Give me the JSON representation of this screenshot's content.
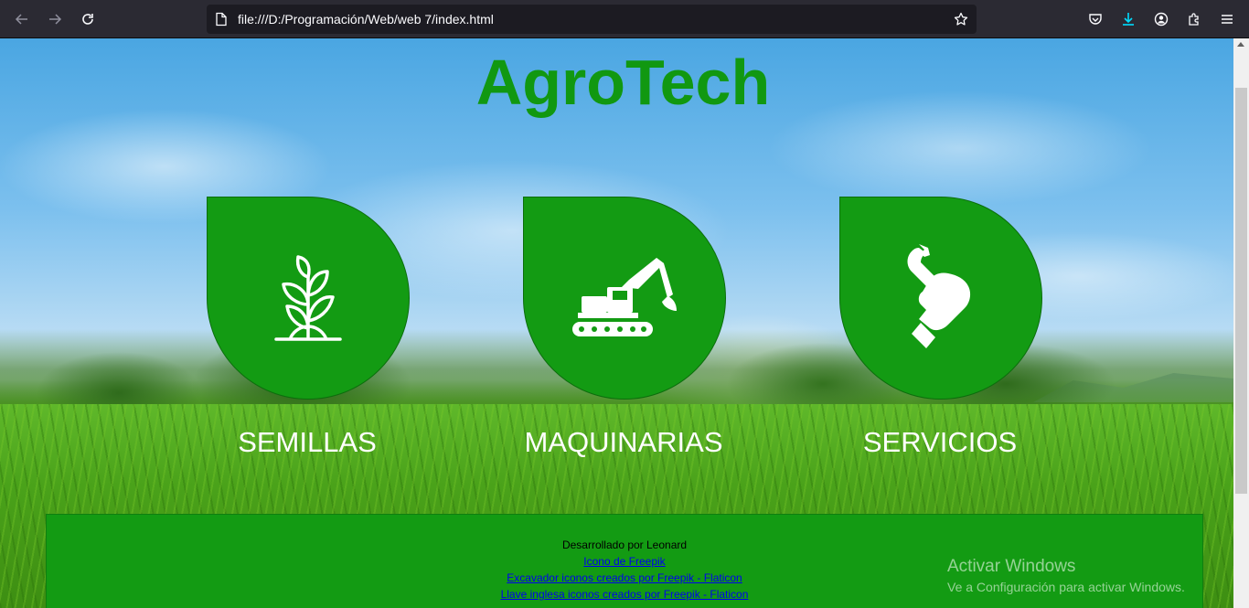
{
  "browser": {
    "url": "file:///D:/Programación/Web/web 7/index.html",
    "icons": [
      "back-icon",
      "forward-icon",
      "reload-icon",
      "page-icon",
      "bookmark-star-icon",
      "pocket-icon",
      "downloads-icon",
      "account-icon",
      "extensions-icon",
      "menu-icon"
    ],
    "accent_color": "#00ddff"
  },
  "page": {
    "title": "AgroTech",
    "title_color": "#119811",
    "card_color": "#139b13",
    "cards": [
      {
        "label": "SEMILLAS",
        "icon": "seedling-icon"
      },
      {
        "label": "MAQUINARIAS",
        "icon": "excavator-icon"
      },
      {
        "label": "SERVICIOS",
        "icon": "wrench-hand-icon"
      }
    ],
    "footer": {
      "developer": "Desarrollado por Leonard",
      "links": [
        "Icono de Freepik",
        "Excavador iconos creados por Freepik - Flaticon",
        "Llave inglesa iconos creados por Freepik - Flaticon"
      ]
    }
  },
  "os_watermark": {
    "line1": "Activar Windows",
    "line2": "Ve a Configuración para activar Windows."
  }
}
